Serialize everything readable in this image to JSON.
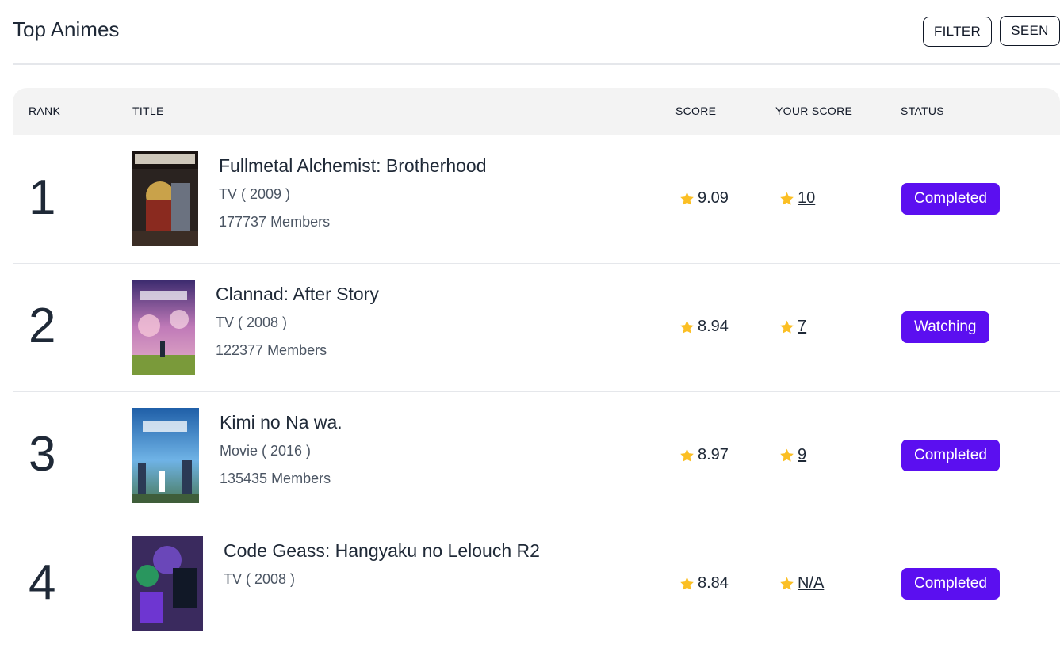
{
  "header": {
    "title": "Top Animes",
    "filter_label": "FILTER",
    "seen_label": "SEEN"
  },
  "table": {
    "columns": {
      "rank": "RANK",
      "title": "TITLE",
      "score": "SCORE",
      "your_score": "YOUR SCORE",
      "status": "STATUS"
    },
    "rows": [
      {
        "rank": "1",
        "title": "Fullmetal Alchemist: Brotherhood",
        "meta": "TV ( 2009 )",
        "members": "177737 Members",
        "score": "9.09",
        "your_score": "10",
        "status": "Completed"
      },
      {
        "rank": "2",
        "title": "Clannad: After Story",
        "meta": "TV ( 2008 )",
        "members": "122377 Members",
        "score": "8.94",
        "your_score": "7",
        "status": "Watching"
      },
      {
        "rank": "3",
        "title": "Kimi no Na wa.",
        "meta": "Movie ( 2016 )",
        "members": "135435 Members",
        "score": "8.97",
        "your_score": "9",
        "status": "Completed"
      },
      {
        "rank": "4",
        "title": "Code Geass: Hangyaku no Lelouch R2",
        "meta": "TV ( 2008 )",
        "members": "",
        "score": "8.84",
        "your_score": "N/A",
        "status": "Completed"
      }
    ]
  },
  "colors": {
    "accent": "#5b0ff0",
    "star": "#fbbf24",
    "header_bg": "#f3f3f3"
  },
  "icons": {
    "score": "star-icon"
  }
}
